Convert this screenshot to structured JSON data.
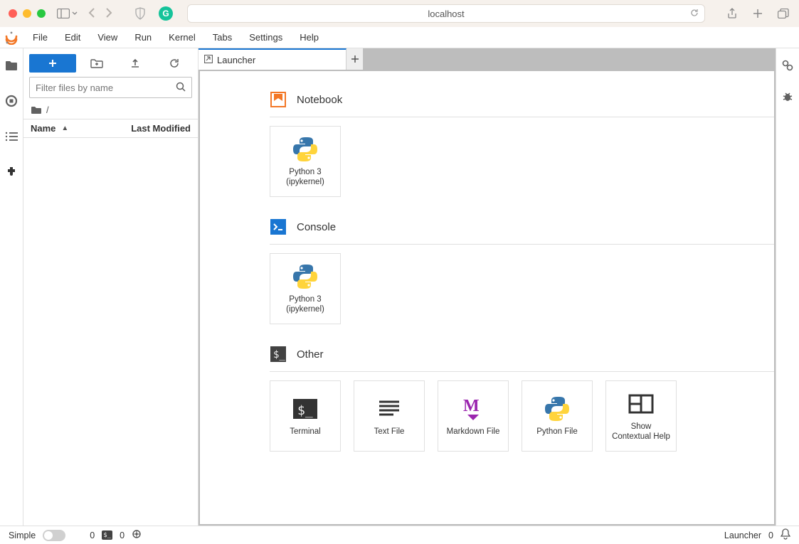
{
  "browser": {
    "address": "localhost"
  },
  "menu": [
    "File",
    "Edit",
    "View",
    "Run",
    "Kernel",
    "Tabs",
    "Settings",
    "Help"
  ],
  "file_panel": {
    "filter_placeholder": "Filter files by name",
    "breadcrumb_root": "/",
    "col_name": "Name",
    "col_modified": "Last Modified"
  },
  "tab": {
    "launcher_label": "Launcher"
  },
  "launcher": {
    "section_notebook": "Notebook",
    "section_console": "Console",
    "section_other": "Other",
    "python_card": "Python 3\n(ipykernel)",
    "other_cards": [
      "Terminal",
      "Text File",
      "Markdown File",
      "Python File",
      "Show\nContextual Help"
    ]
  },
  "status": {
    "simple_label": "Simple",
    "terminals_count": "0",
    "kernels_count": "0",
    "active_tab": "Launcher",
    "right_count": "0"
  }
}
